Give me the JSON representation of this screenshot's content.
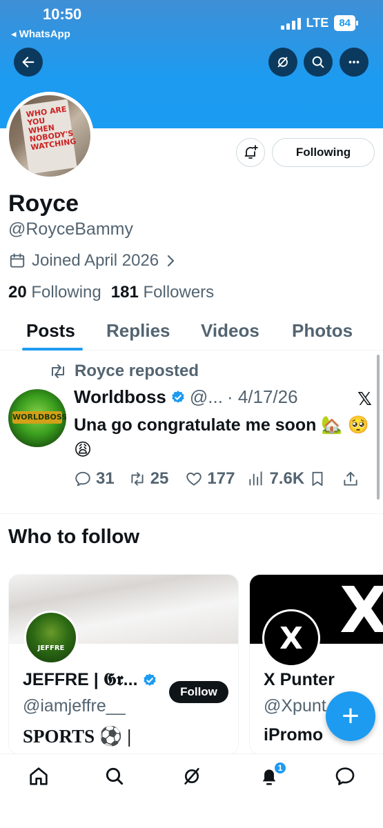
{
  "status_bar": {
    "time": "10:50",
    "back_app": "◂ WhatsApp",
    "network": "LTE",
    "battery": "84"
  },
  "profile": {
    "following_button": "Following",
    "name": "Royce",
    "handle": "@RoyceBammy",
    "joined": "Joined April 2026",
    "following_count": "20",
    "following_label": "Following",
    "followers_count": "181",
    "followers_label": "Followers",
    "avatar_text": "WHO ARE YOU WHEN NOBODY'S WATCHING"
  },
  "tabs": [
    {
      "label": "Posts"
    },
    {
      "label": "Replies"
    },
    {
      "label": "Videos"
    },
    {
      "label": "Photos"
    }
  ],
  "post": {
    "repost_label": "Royce reposted",
    "author_name": "Worldboss",
    "author_handle": "@...",
    "date": "· 4/17/26",
    "text": "Una go congratulate me soon 🏡 🥺 😩",
    "avatar_label": "WORLDBOSS",
    "replies": "31",
    "reposts": "25",
    "likes": "177",
    "views": "7.6K"
  },
  "who_to_follow": {
    "title": "Who to follow",
    "cards": [
      {
        "name": "JEFFRE | 𝕲𝖗...",
        "handle": "@iamjeffre__",
        "bio": "SPORTS ⚽ |",
        "follow_label": "Follow",
        "avatar_label": "JEFFRE"
      },
      {
        "name": "X Punter",
        "handle": "@Xpunt",
        "bio": "iPromo",
        "avatar_label": "X"
      }
    ]
  },
  "fab": {
    "label": "+"
  },
  "bottom_nav": {
    "notification_count": "1"
  },
  "colors": {
    "accent": "#1d9bf0",
    "text": "#0f1419",
    "secondary": "#536471"
  }
}
